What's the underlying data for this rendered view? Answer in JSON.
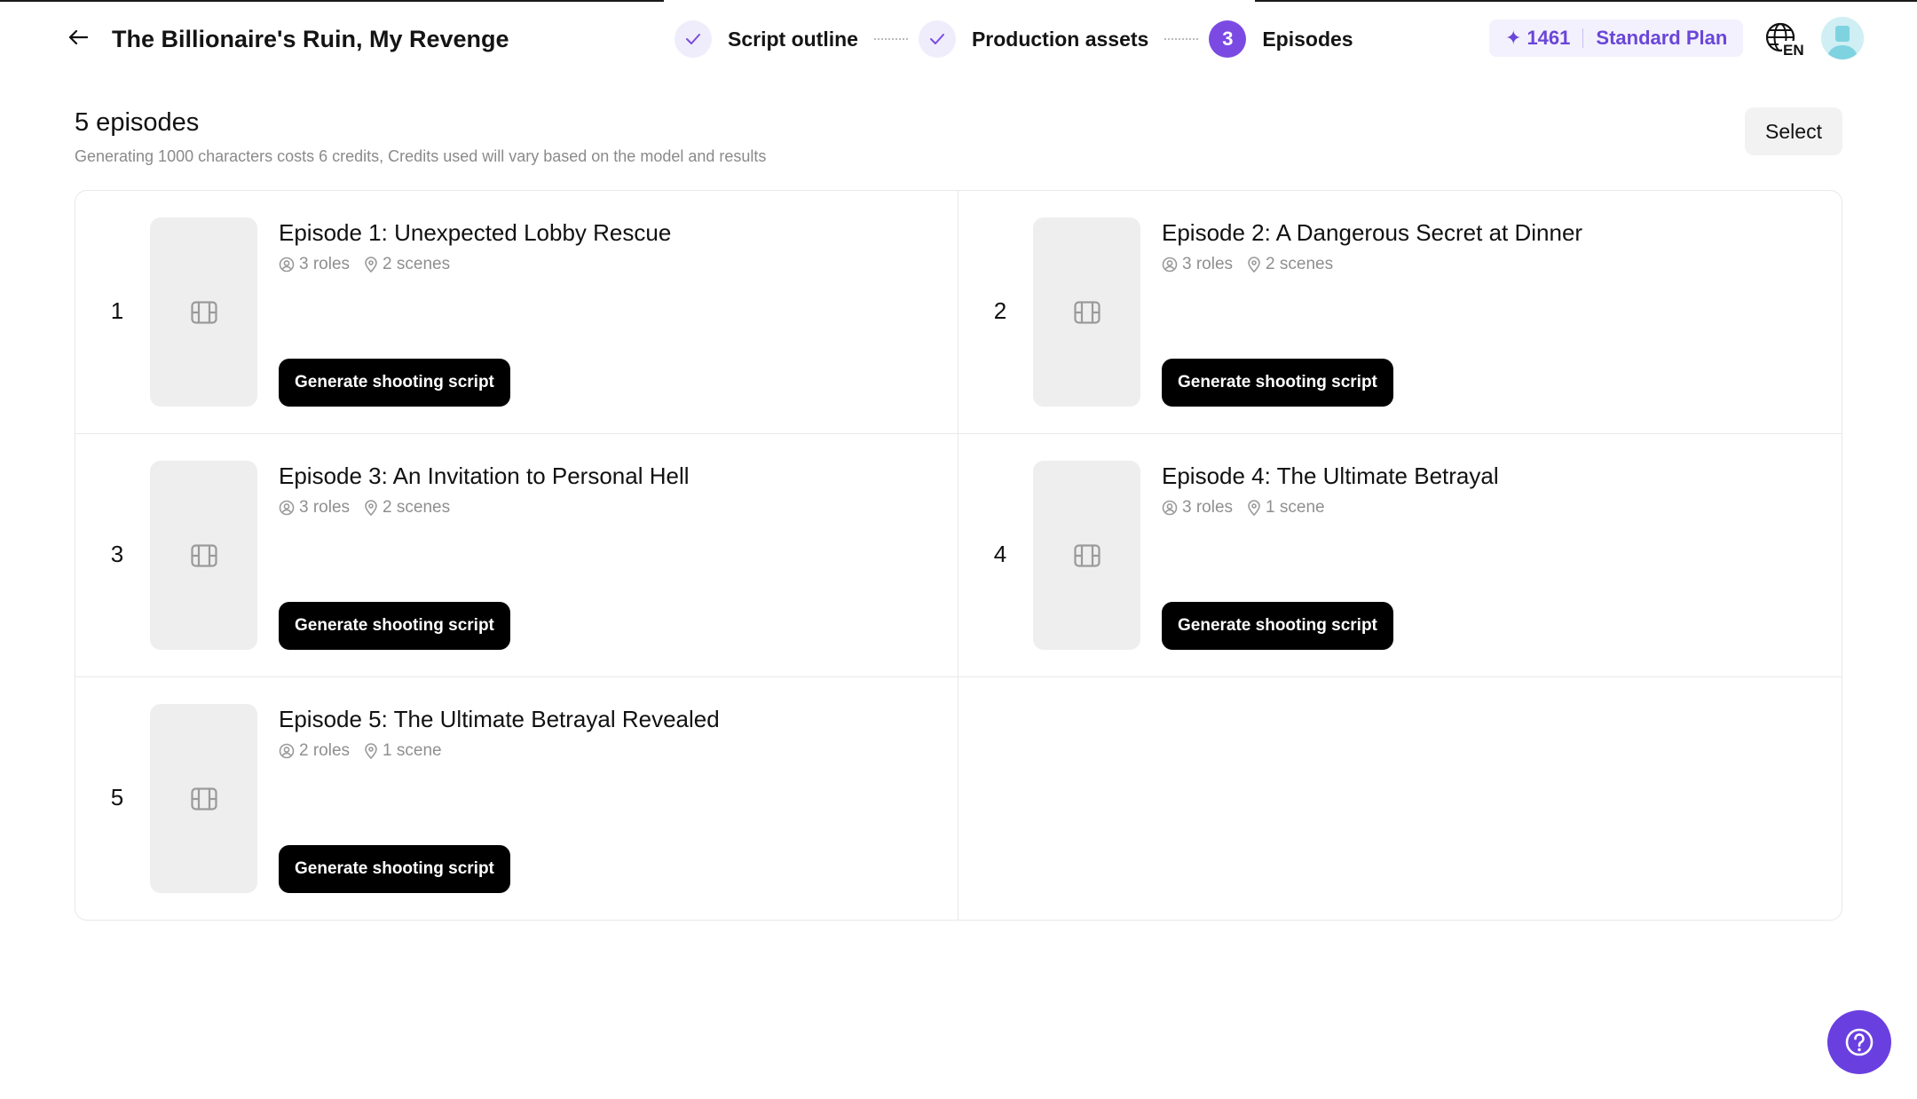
{
  "header": {
    "title": "The Billionaire's Ruin, My Revenge",
    "steps": [
      {
        "label": "Script outline",
        "state": "done"
      },
      {
        "label": "Production assets",
        "state": "done"
      },
      {
        "label": "Episodes",
        "state": "active",
        "number": "3"
      }
    ],
    "credits": "1461",
    "plan": "Standard Plan",
    "language": "EN",
    "accent_color": "#7b4ae2"
  },
  "main": {
    "count_title": "5 episodes",
    "subtitle": "Generating 1000 characters costs 6 credits, Credits used will vary based on the model and results",
    "select_label": "Select",
    "episodes": [
      {
        "number": "1",
        "title": "Episode 1: Unexpected Lobby Rescue",
        "roles": "3 roles",
        "scenes": "2 scenes",
        "button": "Generate shooting script"
      },
      {
        "number": "2",
        "title": "Episode 2: A Dangerous Secret at Dinner",
        "roles": "3 roles",
        "scenes": "2 scenes",
        "button": "Generate shooting script"
      },
      {
        "number": "3",
        "title": "Episode 3: An Invitation to Personal Hell",
        "roles": "3 roles",
        "scenes": "2 scenes",
        "button": "Generate shooting script"
      },
      {
        "number": "4",
        "title": "Episode 4: The Ultimate Betrayal",
        "roles": "3 roles",
        "scenes": "1 scene",
        "button": "Generate shooting script"
      },
      {
        "number": "5",
        "title": "Episode 5: The Ultimate Betrayal Revealed",
        "roles": "2 roles",
        "scenes": "1 scene",
        "button": "Generate shooting script"
      }
    ]
  },
  "icons": {
    "back": "arrow-left-icon",
    "step_done": "check-icon",
    "credit": "sparkle-icon",
    "language": "globe-icon",
    "thumbnail": "film-icon",
    "roles": "user-circle-icon",
    "scenes": "map-pin-icon",
    "help": "help-circle-icon"
  }
}
